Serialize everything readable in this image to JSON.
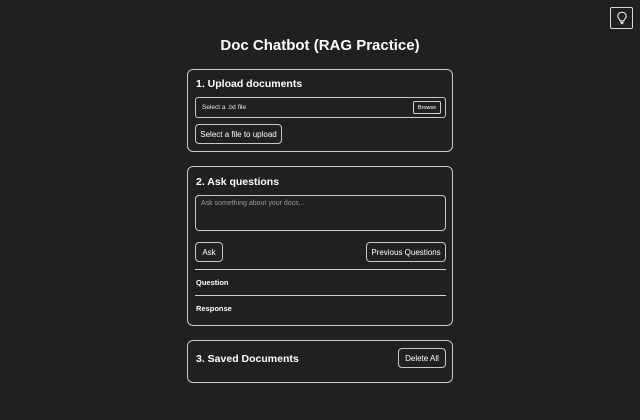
{
  "header": {
    "title": "Doc Chatbot (RAG Practice)",
    "theme_toggle_icon": "lightbulb-icon"
  },
  "upload": {
    "heading": "1. Upload documents",
    "file_picker_text": "Select a .txt file",
    "browse_label": "Browse",
    "upload_button_label": "Select a file to upload"
  },
  "ask": {
    "heading": "2. Ask questions",
    "input_placeholder": "Ask something about your docs...",
    "input_value": "",
    "ask_button_label": "Ask",
    "previous_button_label": "Previous Questions",
    "question_label": "Question",
    "response_label": "Response"
  },
  "saved": {
    "heading": "3. Saved Documents",
    "delete_all_label": "Delete All"
  },
  "colors": {
    "background": "#202020",
    "border": "#c8c8c8",
    "text": "#ffffff",
    "placeholder": "#9a9a9a"
  }
}
